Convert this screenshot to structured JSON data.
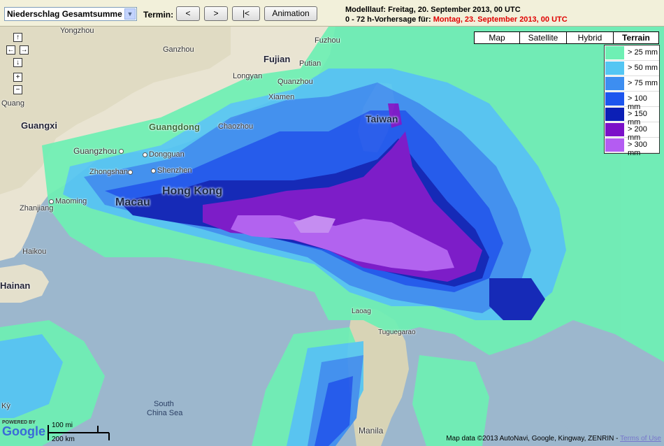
{
  "toolbar": {
    "product_select": "Niederschlag Gesamtsumme",
    "termin_label": "Termin:",
    "btn_prev": "<",
    "btn_next": ">",
    "btn_first": "|<",
    "btn_animation": "Animation"
  },
  "run_info": {
    "line1": "Modelllauf: Freitag, 20. September 2013, 00 UTC",
    "line2_prefix": "0 - 72 h-Vorhersage für: ",
    "line2_date": "Montag, 23. September 2013, 00 UTC"
  },
  "map_types": [
    "Map",
    "Satellite",
    "Hybrid",
    "Terrain"
  ],
  "active_map_type": "Terrain",
  "legend": [
    {
      "label": "> 25 mm",
      "color": "#6ef0b4"
    },
    {
      "label": "> 50 mm",
      "color": "#54c6f3"
    },
    {
      "label": "> 75 mm",
      "color": "#3d8ef1"
    },
    {
      "label": "> 100 mm",
      "color": "#1d55ee"
    },
    {
      "label": "> 150 mm",
      "color": "#0b1fb6"
    },
    {
      "label": "> 200 mm",
      "color": "#7b10c8"
    },
    {
      "label": "> 300 mm",
      "color": "#b45cf2"
    }
  ],
  "places": {
    "yongzhou": "Yongzhou",
    "ganzhou": "Ganzhou",
    "fujian": "Fujian",
    "fuzhou": "Fuzhou",
    "putian": "Putian",
    "longyan": "Longyan",
    "quanzhou": "Quanzhou",
    "xiamen": "Xiamen",
    "guangxi": "Guangxi",
    "guangdong": "Guangdong",
    "chaozhou": "Chaozhou",
    "taiwan": "Taiwan",
    "guangzhou": "Guangzhou",
    "dongguan": "Dongguan",
    "zhongshan": "Zhongshan",
    "shenzhen": "Shenzhen",
    "hongkong": "Hong Kong",
    "macau": "Macau",
    "maoming": "Maoming",
    "zhanjiang": "Zhanjiang",
    "haikou": "Haikou",
    "hainan": "Hainan",
    "quang": "Quang",
    "laoag": "Laoag",
    "tuguegarao": "Tuguegarao",
    "south_china_sea_1": "South",
    "south_china_sea_2": "China Sea",
    "manila": "Manila",
    "ky": "Kỳ"
  },
  "scale": {
    "mi": "100 mi",
    "km": "200 km"
  },
  "google_logo": {
    "powered": "POWERED BY",
    "name": "Google"
  },
  "copyright": {
    "text": "Map data ©2013 AutoNavi, Google, Kingway, ZENRIN - ",
    "terms": "Terms of Use"
  }
}
